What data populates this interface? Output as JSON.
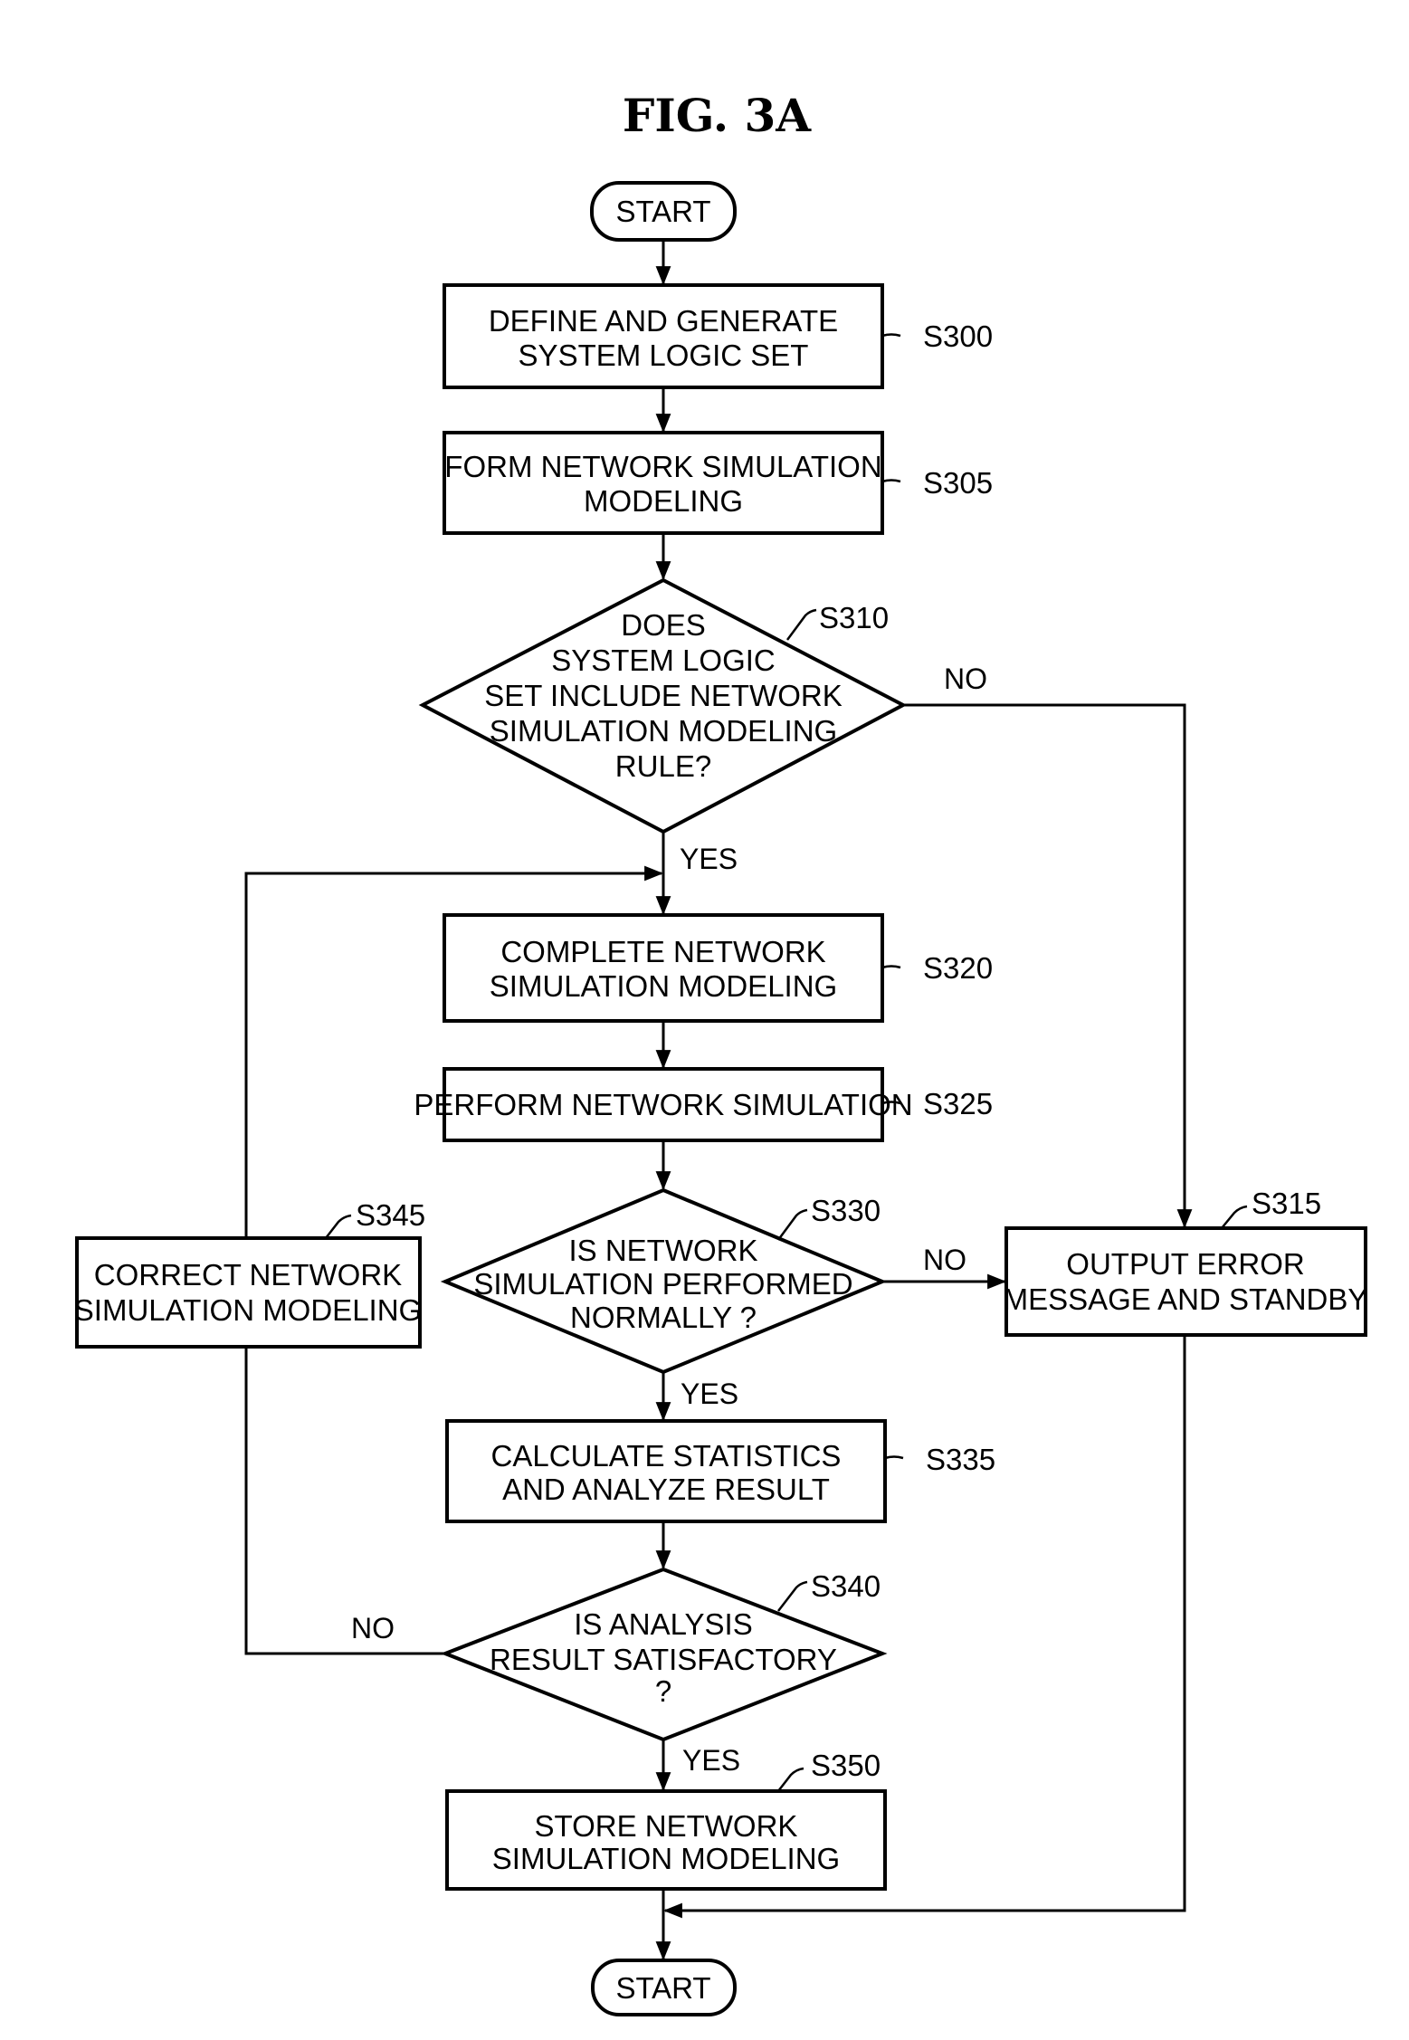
{
  "figure": {
    "title": "FIG. 3A"
  },
  "nodes": {
    "start": {
      "type": "terminal",
      "text": [
        "START"
      ]
    },
    "s300": {
      "type": "process",
      "id": "S300",
      "text": [
        "DEFINE AND GENERATE",
        "SYSTEM LOGIC SET"
      ]
    },
    "s305": {
      "type": "process",
      "id": "S305",
      "text": [
        "FORM NETWORK SIMULATION",
        "MODELING"
      ]
    },
    "s310": {
      "type": "decision",
      "id": "S310",
      "text": [
        "DOES",
        "SYSTEM LOGIC",
        "SET INCLUDE NETWORK",
        "SIMULATION MODELING",
        "RULE?"
      ]
    },
    "s315": {
      "type": "process",
      "id": "S315",
      "text": [
        "OUTPUT ERROR",
        "MESSAGE AND STANDBY"
      ]
    },
    "s320": {
      "type": "process",
      "id": "S320",
      "text": [
        "COMPLETE NETWORK",
        "SIMULATION MODELING"
      ]
    },
    "s325": {
      "type": "process",
      "id": "S325",
      "text": [
        "PERFORM NETWORK SIMULATION"
      ]
    },
    "s330": {
      "type": "decision",
      "id": "S330",
      "text": [
        "IS  NETWORK",
        "SIMULATION PERFORMED",
        "NORMALLY ?"
      ]
    },
    "s335": {
      "type": "process",
      "id": "S335",
      "text": [
        "CALCULATE STATISTICS",
        "AND ANALYZE RESULT"
      ]
    },
    "s340": {
      "type": "decision",
      "id": "S340",
      "text": [
        "IS ANALYSIS",
        "RESULT SATISFACTORY",
        "?"
      ]
    },
    "s345": {
      "type": "process",
      "id": "S345",
      "text": [
        "CORRECT NETWORK",
        "SIMULATION MODELING"
      ]
    },
    "s350": {
      "type": "process",
      "id": "S350",
      "text": [
        "STORE NETWORK",
        "SIMULATION MODELING"
      ]
    },
    "end": {
      "type": "terminal",
      "text": [
        "START"
      ]
    }
  },
  "edges": [
    {
      "from": "start",
      "to": "s300",
      "label": ""
    },
    {
      "from": "s300",
      "to": "s305",
      "label": ""
    },
    {
      "from": "s305",
      "to": "s310",
      "label": ""
    },
    {
      "from": "s310",
      "to": "s320",
      "label": "YES"
    },
    {
      "from": "s310",
      "to": "s315",
      "label": "NO"
    },
    {
      "from": "s320",
      "to": "s325",
      "label": ""
    },
    {
      "from": "s325",
      "to": "s330",
      "label": ""
    },
    {
      "from": "s330",
      "to": "s335",
      "label": "YES"
    },
    {
      "from": "s330",
      "to": "s315",
      "label": "NO"
    },
    {
      "from": "s335",
      "to": "s340",
      "label": ""
    },
    {
      "from": "s340",
      "to": "s350",
      "label": "YES"
    },
    {
      "from": "s340",
      "to": "s345",
      "label": "NO"
    },
    {
      "from": "s345",
      "to": "s320",
      "label": ""
    },
    {
      "from": "s350",
      "to": "end",
      "label": ""
    },
    {
      "from": "s315",
      "to": "end",
      "label": ""
    }
  ],
  "labels": {
    "yes": "YES",
    "no": "NO"
  }
}
